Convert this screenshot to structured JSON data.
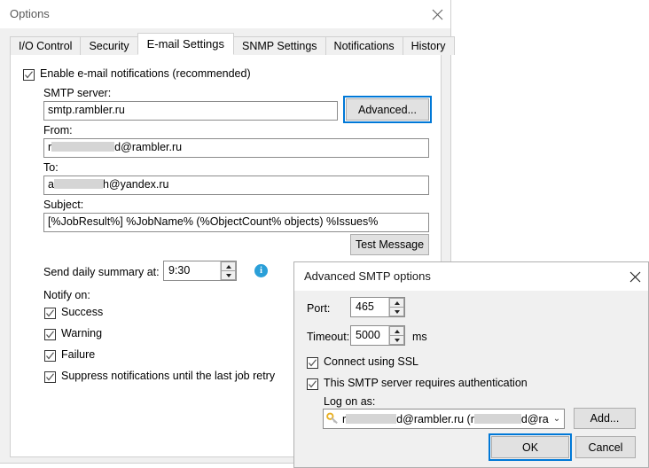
{
  "options_dialog": {
    "title": "Options",
    "close_icon": "close-icon",
    "tabs": [
      {
        "label": "I/O Control",
        "active": false
      },
      {
        "label": "Security",
        "active": false
      },
      {
        "label": "E-mail Settings",
        "active": true
      },
      {
        "label": "SNMP Settings",
        "active": false
      },
      {
        "label": "Notifications",
        "active": false
      },
      {
        "label": "History",
        "active": false
      }
    ],
    "enable_email": {
      "label": "Enable e-mail notifications (recommended)",
      "checked": true
    },
    "smtp_server": {
      "label": "SMTP server:",
      "value": "smtp.rambler.ru"
    },
    "advanced_button": {
      "label": "Advanced...",
      "focused": true
    },
    "from": {
      "label": "From:",
      "prefix": "r",
      "redacted": true,
      "suffix": "d@rambler.ru"
    },
    "to": {
      "label": "To:",
      "prefix": "a",
      "redacted": true,
      "suffix": "h@yandex.ru"
    },
    "subject": {
      "label": "Subject:",
      "value": "[%JobResult%] %JobName% (%ObjectCount% objects) %Issues%"
    },
    "test_message_button": {
      "label": "Test Message"
    },
    "daily_summary": {
      "label": "Send daily summary at:",
      "value": "9:30",
      "info_icon": "info-icon",
      "info_glyph": "i"
    },
    "notify_on": {
      "label": "Notify on:",
      "items": [
        {
          "label": "Success",
          "checked": true
        },
        {
          "label": "Warning",
          "checked": true
        },
        {
          "label": "Failure",
          "checked": true
        },
        {
          "label": "Suppress notifications until the last job retry",
          "checked": true
        }
      ]
    }
  },
  "smtp_dialog": {
    "title": "Advanced SMTP options",
    "close_icon": "close-icon",
    "port": {
      "label": "Port:",
      "value": "465"
    },
    "timeout": {
      "label": "Timeout:",
      "value": "5000",
      "unit": "ms"
    },
    "ssl": {
      "label": "Connect using SSL",
      "checked": true
    },
    "auth": {
      "label": "This SMTP server requires authentication",
      "checked": true
    },
    "logon": {
      "label": "Log on as:",
      "key_icon": "key-icon",
      "cred_prefix": "r",
      "cred_suffix": "d@rambler.ru  (r",
      "cred_tail": "d@ra",
      "caret_icon": "chevron-down-icon",
      "caret_glyph": "⌄"
    },
    "add_button": {
      "label": "Add..."
    },
    "ok_button": {
      "label": "OK",
      "focused": true
    },
    "cancel_button": {
      "label": "Cancel"
    }
  },
  "background": {
    "chevron_icon": "chevron-down-icon",
    "chevron_glyph": "⌄"
  },
  "colors": {
    "accent": "#0078d7",
    "dialog_bg": "#f0f0f0",
    "info_blue": "#2a9fd8",
    "key_gold": "#e8b023"
  }
}
